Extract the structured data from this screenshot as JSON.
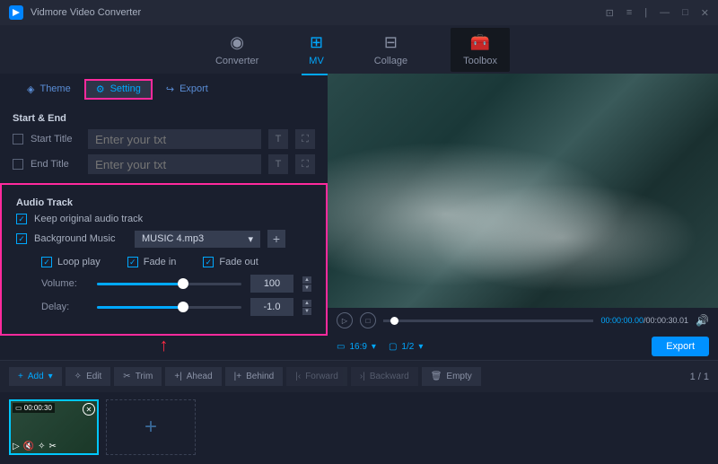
{
  "app": {
    "title": "Vidmore Video Converter"
  },
  "maintabs": {
    "converter": "Converter",
    "mv": "MV",
    "collage": "Collage",
    "toolbox": "Toolbox"
  },
  "subtabs": {
    "theme": "Theme",
    "setting": "Setting",
    "export": "Export"
  },
  "startEnd": {
    "title": "Start & End",
    "startTitle": "Start Title",
    "endTitle": "End Title",
    "placeholder": "Enter your txt"
  },
  "audio": {
    "title": "Audio Track",
    "keepOriginal": "Keep original audio track",
    "backgroundMusic": "Background Music",
    "musicFile": "MUSIC 4.mp3",
    "loopPlay": "Loop play",
    "fadeIn": "Fade in",
    "fadeOut": "Fade out",
    "volumeLabel": "Volume:",
    "volumeValue": "100",
    "delayLabel": "Delay:",
    "delayValue": "-1.0"
  },
  "player": {
    "currentTime": "00:00:00.00",
    "totalTime": "00:00:30.01",
    "aspectRatio": "16:9",
    "preview": "1/2"
  },
  "export": "Export",
  "toolbar": {
    "add": "Add",
    "edit": "Edit",
    "trim": "Trim",
    "ahead": "Ahead",
    "behind": "Behind",
    "forward": "Forward",
    "backward": "Backward",
    "empty": "Empty"
  },
  "page": {
    "current": "1",
    "total": "1"
  },
  "clip": {
    "duration": "00:00:30"
  }
}
